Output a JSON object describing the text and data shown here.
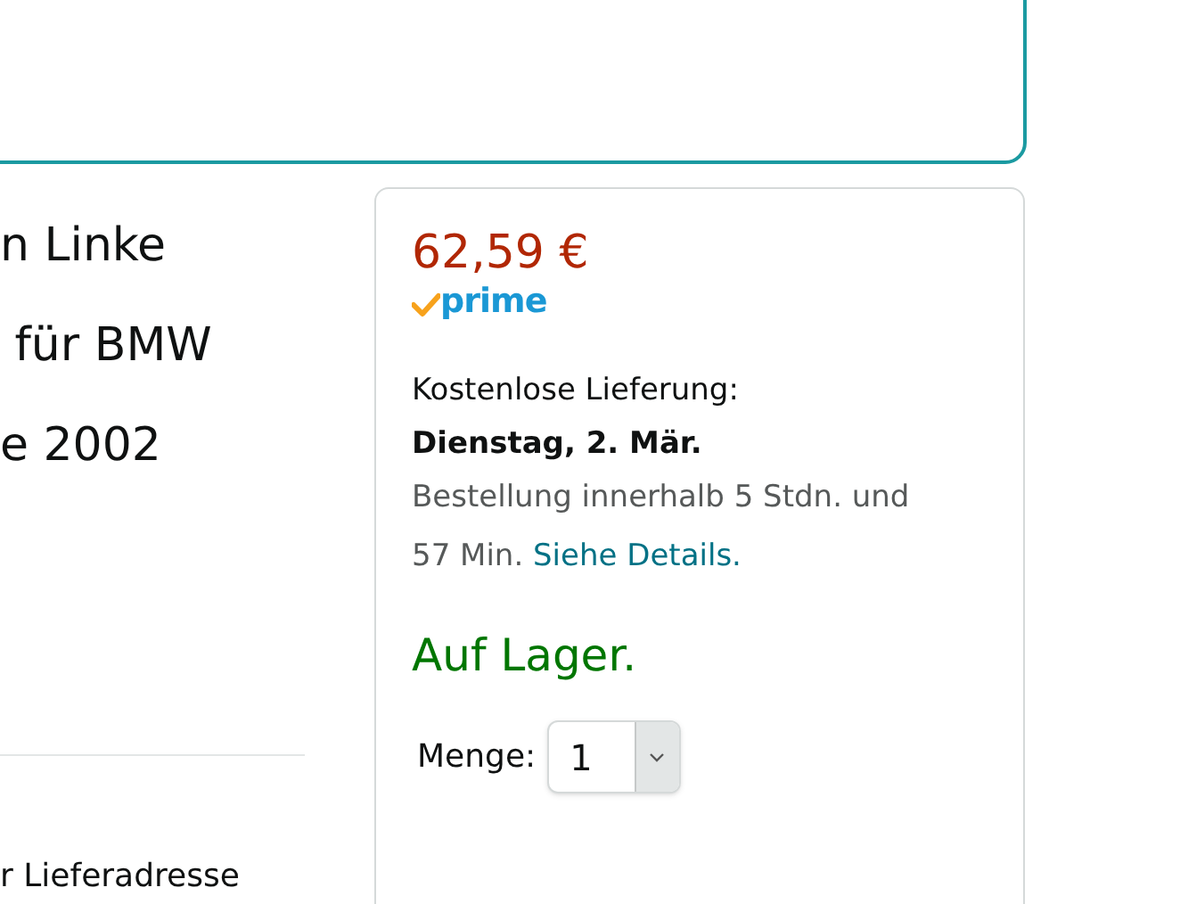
{
  "product_title_lines": [
    "n Linke",
    " für BMW",
    "e 2002"
  ],
  "address_note": "r Lieferadresse",
  "buy_box": {
    "price": "62,59 €",
    "prime_label": "prime",
    "delivery_label": "Kostenlose Lieferung:",
    "delivery_date": "Dienstag, 2. Mär.",
    "order_within": "Bestellung innerhalb 5 Stdn. und 57 Min.",
    "details_link": "Siehe Details.",
    "availability": "Auf Lager.",
    "quantity": {
      "label": "Menge:",
      "value": "1"
    }
  }
}
